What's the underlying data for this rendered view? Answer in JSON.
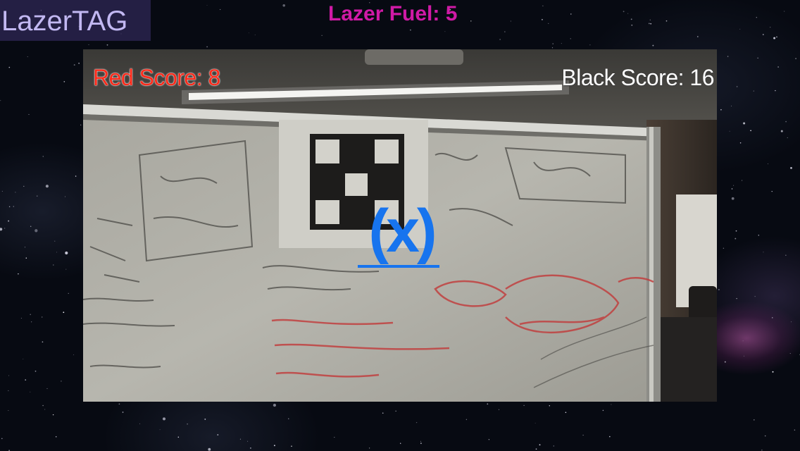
{
  "app": {
    "title": "LazerTAG"
  },
  "hud": {
    "fuel_label": "Lazer Fuel: 5",
    "fuel_value": 5,
    "red_score_label": "Red Score: 8",
    "red_score_value": 8,
    "black_score_label": "Black Score: 16",
    "black_score_value": 16,
    "crosshair_label": "(x)"
  },
  "icons": {
    "crosshair": "crosshair-icon",
    "target_marker": "fiducial-marker-icon"
  },
  "colors": {
    "title_bg": "#3c326e",
    "title_text": "#c2b8f2",
    "fuel_text": "#d01aa6",
    "red_score": "#ff2a1a",
    "black_score": "#ffffff",
    "crosshair": "#1774ee",
    "space_bg": "#070a12"
  }
}
